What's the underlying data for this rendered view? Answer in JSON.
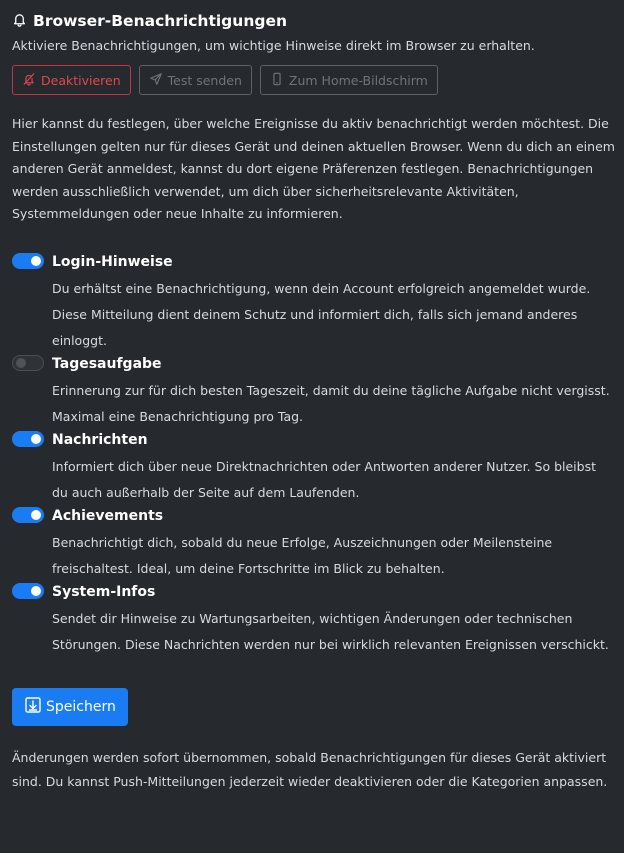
{
  "header": {
    "title": "Browser-Benachrichtigungen",
    "subtitle": "Aktiviere Benachrichtigungen, um wichtige Hinweise direkt im Browser zu erhalten."
  },
  "actions": {
    "deactivate_label": "Deaktivieren",
    "test_label": "Test senden",
    "homescreen_label": "Zum Home-Bildschirm"
  },
  "intro": "Hier kannst du festlegen, über welche Ereignisse du aktiv benachrichtigt werden möchtest. Die Einstellungen gelten nur für dieses Gerät und deinen aktuellen Browser. Wenn du dich an einem anderen Gerät anmeldest, kannst du dort eigene Präferenzen festlegen. Benachrichtigungen werden ausschließlich verwendet, um dich über sicherheitsrelevante Aktivitäten, Systemmeldungen oder neue Inhalte zu informieren.",
  "settings": [
    {
      "label": "Login-Hinweise",
      "enabled": true,
      "description": "Du erhältst eine Benachrichtigung, wenn dein Account erfolgreich angemeldet wurde. Diese Mitteilung dient deinem Schutz und informiert dich, falls sich jemand anderes einloggt."
    },
    {
      "label": "Tagesaufgabe",
      "enabled": false,
      "description": "Erinnerung zur für dich besten Tageszeit, damit du deine tägliche Aufgabe nicht vergisst. Maximal eine Benachrichtigung pro Tag."
    },
    {
      "label": "Nachrichten",
      "enabled": true,
      "description": "Informiert dich über neue Direktnachrichten oder Antworten anderer Nutzer. So bleibst du auch außerhalb der Seite auf dem Laufenden."
    },
    {
      "label": "Achievements",
      "enabled": true,
      "description": "Benachrichtigt dich, sobald du neue Erfolge, Auszeichnungen oder Meilensteine freischaltest. Ideal, um deine Fortschritte im Blick zu behalten."
    },
    {
      "label": "System-Infos",
      "enabled": true,
      "description": "Sendet dir Hinweise zu Wartungsarbeiten, wichtigen Änderungen oder technischen Störungen. Diese Nachrichten werden nur bei wirklich relevanten Ereignissen verschickt."
    }
  ],
  "save_label": "Speichern",
  "footer": "Änderungen werden sofort übernommen, sobald Benachrichtigungen für dieses Gerät aktiviert sind. Du kannst Push-Mitteilungen jederzeit wieder deaktivieren oder die Kategorien anpassen.",
  "colors": {
    "background": "#26292e",
    "accent": "#1a7cf2",
    "danger": "#e0474f",
    "text": "#d7dade",
    "muted": "#6f747a"
  },
  "icons": {
    "title": "bell-icon",
    "deactivate": "bell-slash-icon",
    "test": "send-icon",
    "homescreen": "mobile-icon",
    "save": "download-box-icon"
  }
}
